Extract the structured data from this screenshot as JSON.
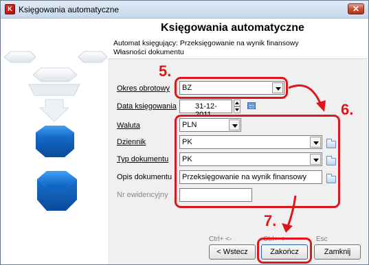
{
  "window": {
    "title": "Księgowania automatyczne",
    "close_glyph": "✕",
    "app_icon_glyph": "K"
  },
  "header": {
    "title": "Księgowania automatyczne",
    "subtitle1": "Automat księgujący: Przeksięgowanie na wynik finansowy",
    "subtitle2": "Własności dokumentu"
  },
  "form": {
    "okres_label": "Okres obrotowy",
    "okres_value": "BZ",
    "data_label": "Data księgowania",
    "data_value": "31-12-2011",
    "waluta_label": "Waluta",
    "waluta_value": "PLN",
    "dziennik_label": "Dziennik",
    "dziennik_value": "PK",
    "typ_label": "Typ dokumentu",
    "typ_value": "PK",
    "opis_label": "Opis dokumentu",
    "opis_value": "Przeksięgowanie na wynik finansowy",
    "nr_label": "Nr ewidencyjny",
    "nr_value": ""
  },
  "buttons": {
    "back_label": "< Wstecz",
    "back_hint": "Ctrl+ <-",
    "finish_label": "Zakończ",
    "finish_hint": "Ctrl+ ->",
    "close_label": "Zamknij",
    "close_hint": "Esc"
  },
  "annotations": {
    "step5": "5.",
    "step6": "6.",
    "step7": "7."
  },
  "colors": {
    "highlight": "#e0141b",
    "accent_blue": "#1e78d8"
  }
}
